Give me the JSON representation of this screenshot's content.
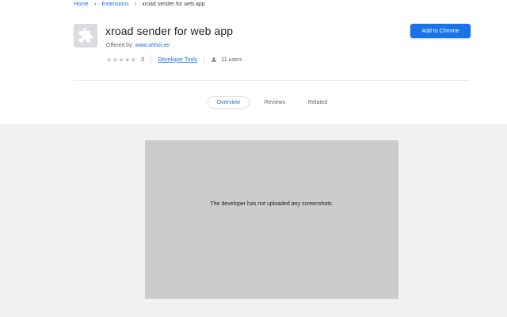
{
  "breadcrumb": {
    "home": "Home",
    "extensions": "Extensions",
    "current": "xroad sender for web app",
    "separator": "›"
  },
  "extension": {
    "icon": "puzzle-piece-icon",
    "title": "xroad sender for web app",
    "offered_by_label": "Offered by:",
    "offered_by_link": "www.ahhoi.ee",
    "rating_stars": "★★★★★",
    "rating_count": "0",
    "category": "Developer Tools",
    "users_icon": "person-icon",
    "users": "11 users"
  },
  "actions": {
    "add_label": "Add to Chrome"
  },
  "tabs": [
    {
      "label": "Overview",
      "active": true
    },
    {
      "label": "Reviews",
      "active": false
    },
    {
      "label": "Related",
      "active": false
    }
  ],
  "screenshots": {
    "empty_message": "The developer has not uploaded any screenshots."
  },
  "colors": {
    "accent": "#1a73e8",
    "gray_area": "#f1f1f1",
    "placeholder": "#cccccc"
  }
}
